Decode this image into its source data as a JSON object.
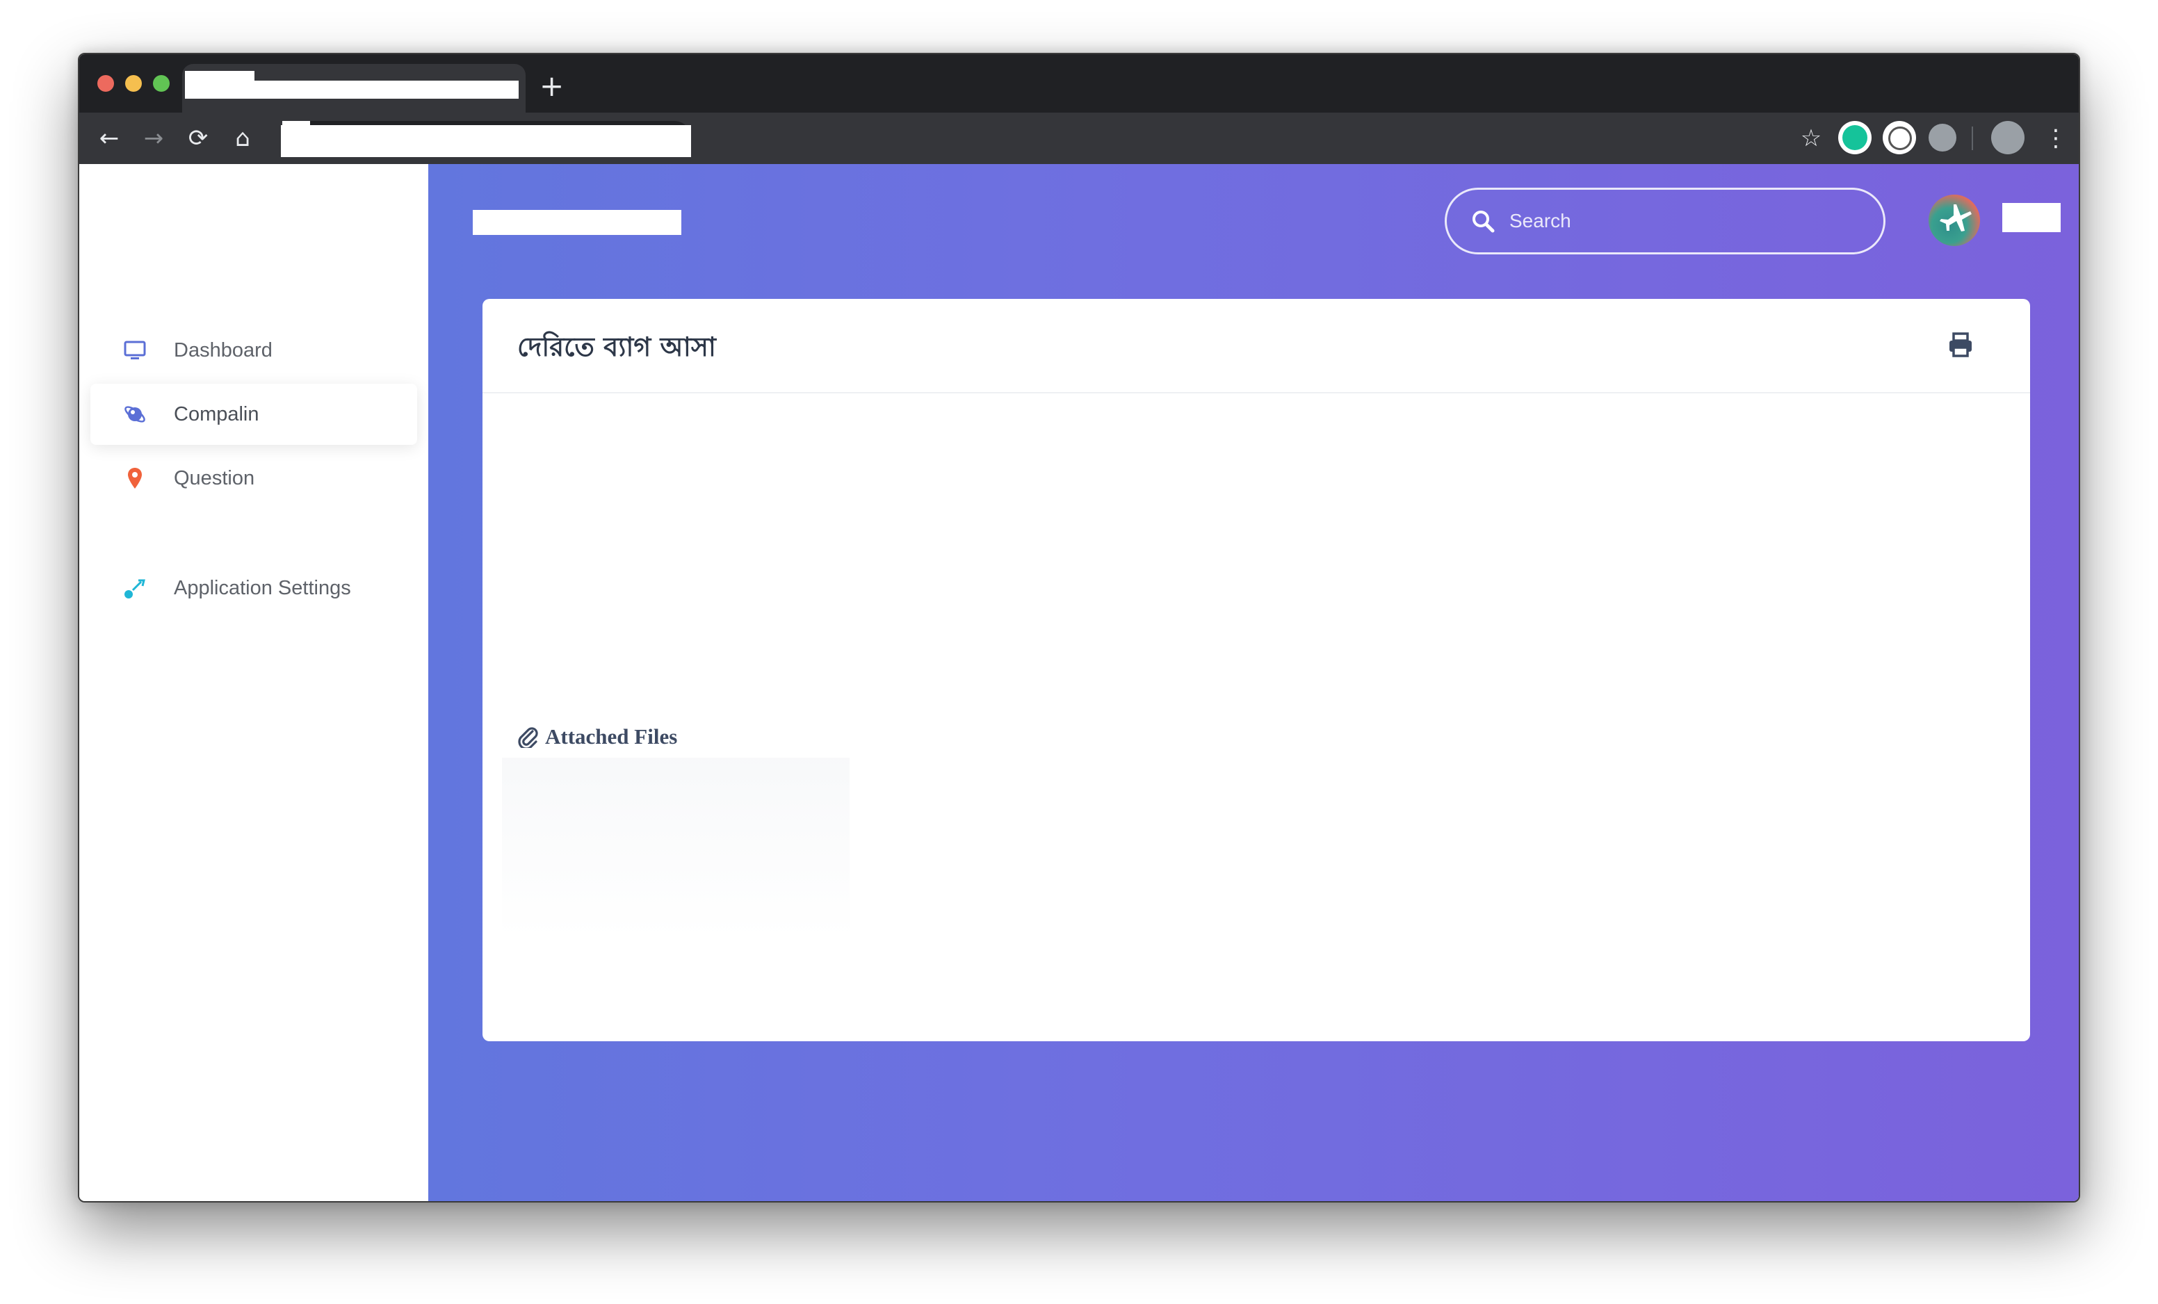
{
  "browser": {
    "new_tab_label": "+",
    "nav": {
      "back": "←",
      "forward": "→",
      "reload": "⟳",
      "home": "⌂",
      "bookmark": "☆",
      "menu": "⋮"
    }
  },
  "sidebar": {
    "items": [
      {
        "label": "Dashboard",
        "icon": "monitor-icon",
        "color": "#5b6fd6"
      },
      {
        "label": "Compalin",
        "icon": "planet-icon",
        "color": "#5b6fd6",
        "active": true
      },
      {
        "label": "Question",
        "icon": "map-pin-icon",
        "color": "#f0623b"
      },
      {
        "label": "Application Settings",
        "icon": "satellite-dish-icon",
        "color": "#1fb6d6"
      }
    ]
  },
  "header": {
    "search_placeholder": "Search"
  },
  "card": {
    "title": "দেরিতে ব্যাগ আসা",
    "attached_files_label": "Attached Files"
  },
  "colors": {
    "gradient_start": "#6276de",
    "gradient_end": "#7b62dc",
    "title_text": "#2d3748",
    "attached_text": "#3d4a63"
  }
}
